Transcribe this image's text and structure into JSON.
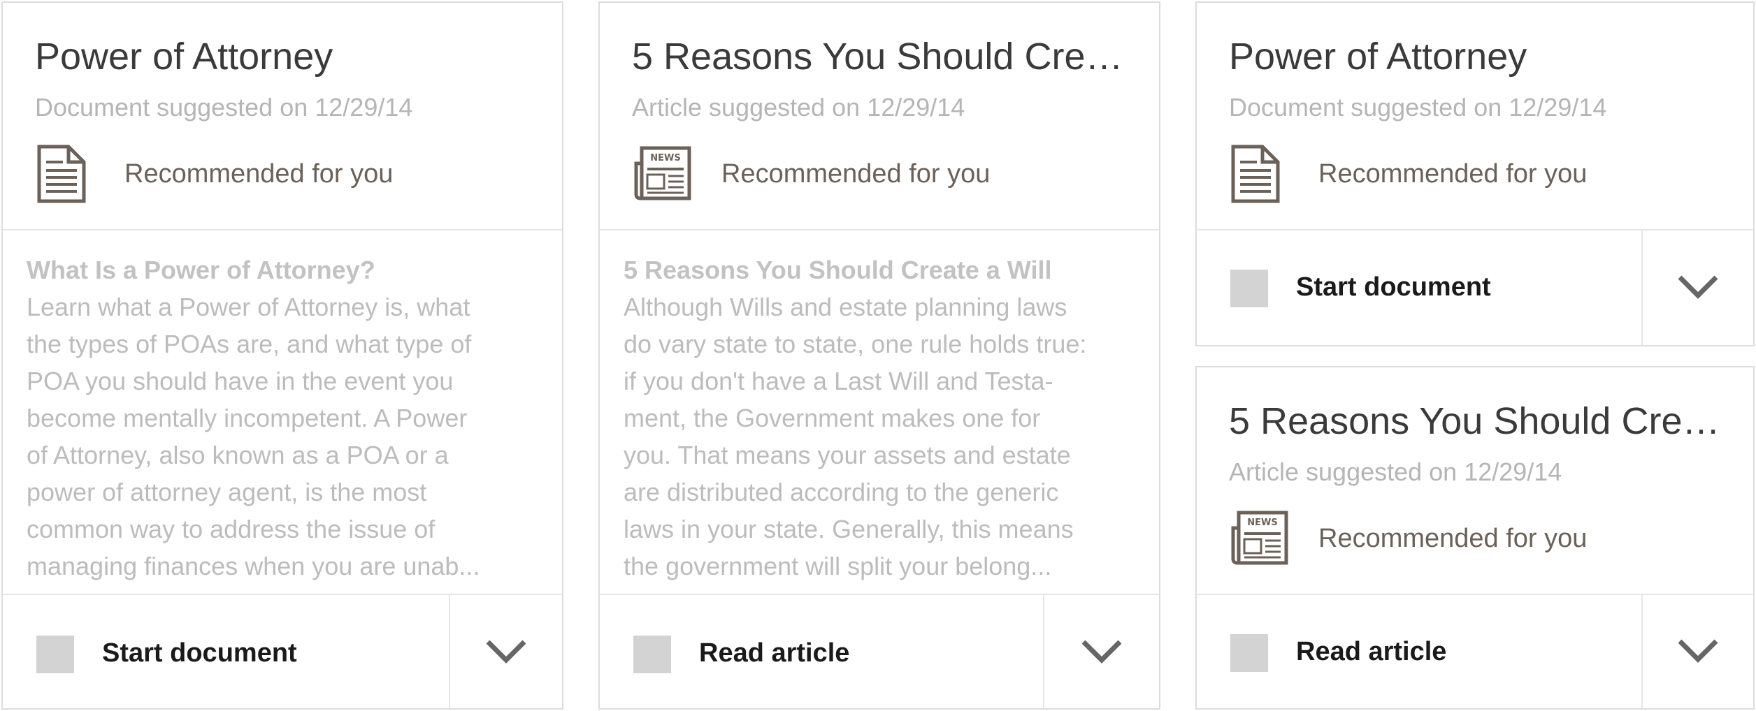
{
  "cards": [
    {
      "title": "Power of Attorney",
      "subtitle": "Document suggested on 12/29/14",
      "icon": "document-icon",
      "recommendation": "Recommended for you",
      "preview_heading": "What Is a Power of Attorney?",
      "preview_lines": [
        "Learn what a Power of Attorney is, what",
        "the types of POAs are, and what type of",
        "POA you should have in the event you",
        "become mentally incompetent. A Power",
        "of Attorney, also known as a POA or a",
        "power of attorney agent, is the most",
        "common way to address the issue of",
        "managing finances when you are unab..."
      ],
      "action_label": "Start document"
    },
    {
      "title": "5 Reasons You Should Crea...",
      "subtitle": "Article suggested on 12/29/14",
      "icon": "newspaper-icon",
      "recommendation": "Recommended for you",
      "preview_heading": "5 Reasons You Should Create a Will",
      "preview_lines": [
        "Although Wills and estate planning laws",
        "do vary state to state, one rule holds true:",
        "if you don't have a Last Will and Testa-",
        "ment, the Government makes one for",
        "you. That means your assets and estate",
        "are distributed according to the generic",
        "laws in your state. Generally, this means",
        "the government will split your belong..."
      ],
      "action_label": "Read article"
    },
    {
      "title": "Power of Attorney",
      "subtitle": "Document suggested on 12/29/14",
      "icon": "document-icon",
      "recommendation": "Recommended for you",
      "action_label": "Start document"
    },
    {
      "title": "5 Reasons You Should Crea...",
      "subtitle": "Article suggested on 12/29/14",
      "icon": "newspaper-icon",
      "recommendation": "Recommended for you",
      "action_label": "Read article"
    }
  ],
  "newspaper_icon_text": "NEWS",
  "colors": {
    "border": "#dddddd",
    "title": "#3a3a3a",
    "subtitle": "#b5b5b5",
    "icon": "#6b6158",
    "checkbox": "#d3d3d3",
    "chevron": "#666666"
  }
}
